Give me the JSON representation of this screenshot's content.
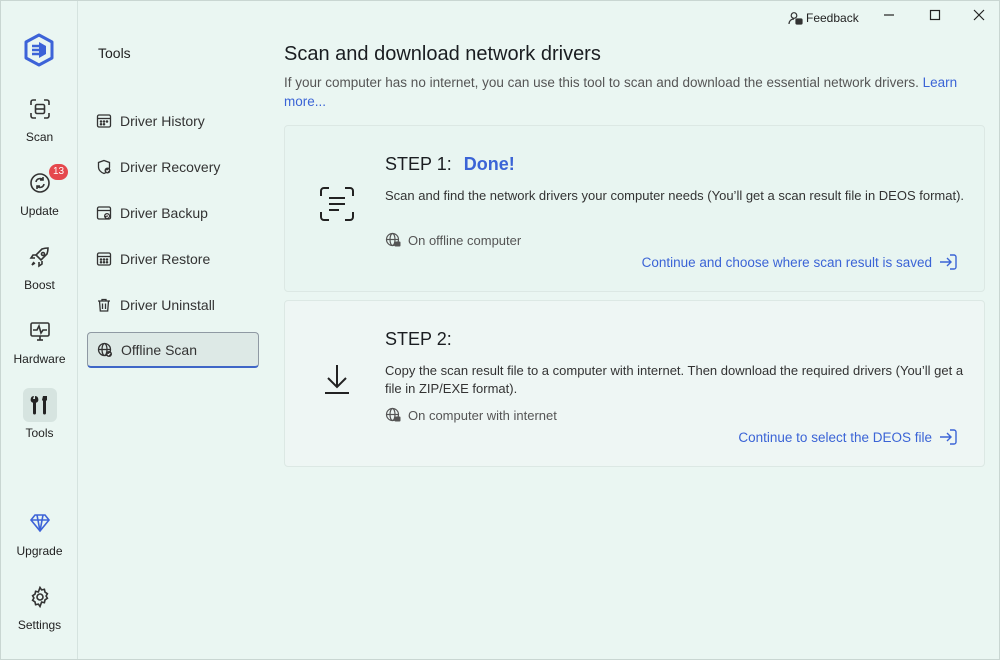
{
  "window": {
    "feedback_label": "Feedback"
  },
  "rail": {
    "items": [
      {
        "label": "Scan",
        "icon": "scan-icon"
      },
      {
        "label": "Update",
        "icon": "refresh-icon",
        "badge": "13"
      },
      {
        "label": "Boost",
        "icon": "rocket-icon"
      },
      {
        "label": "Hardware",
        "icon": "monitor-pulse-icon"
      },
      {
        "label": "Tools",
        "icon": "tools-icon"
      },
      {
        "label": "Upgrade",
        "icon": "diamond-icon"
      },
      {
        "label": "Settings",
        "icon": "gear-icon"
      }
    ]
  },
  "tools": {
    "title": "Tools",
    "items": [
      {
        "label": "Driver History",
        "icon": "history-icon"
      },
      {
        "label": "Driver Recovery",
        "icon": "shield-check-icon"
      },
      {
        "label": "Driver Backup",
        "icon": "backup-icon"
      },
      {
        "label": "Driver Restore",
        "icon": "restore-icon"
      },
      {
        "label": "Driver Uninstall",
        "icon": "trash-icon"
      },
      {
        "label": "Offline Scan",
        "icon": "globe-scan-icon",
        "selected": true
      }
    ]
  },
  "main": {
    "title": "Scan and download network drivers",
    "description": "If your computer has no internet, you can use this tool to scan and download the essential network drivers. ",
    "learn_more": "Learn more...",
    "step1": {
      "label": "STEP 1:",
      "status": "Done!",
      "text": "Scan and find the network drivers your computer needs (You’ll get a scan result file in DEOS format).",
      "location": "On offline computer",
      "action": "Continue and choose where scan result is saved"
    },
    "step2": {
      "label": "STEP 2:",
      "text": "Copy the scan result file to a computer with internet. Then download the required drivers (You’ll get a file in ZIP/EXE format).",
      "location": "On computer with internet",
      "action": "Continue to select the DEOS file"
    }
  },
  "colors": {
    "accent": "#3b64d6",
    "badge": "#e5484d",
    "background": "#eaf6f2"
  }
}
